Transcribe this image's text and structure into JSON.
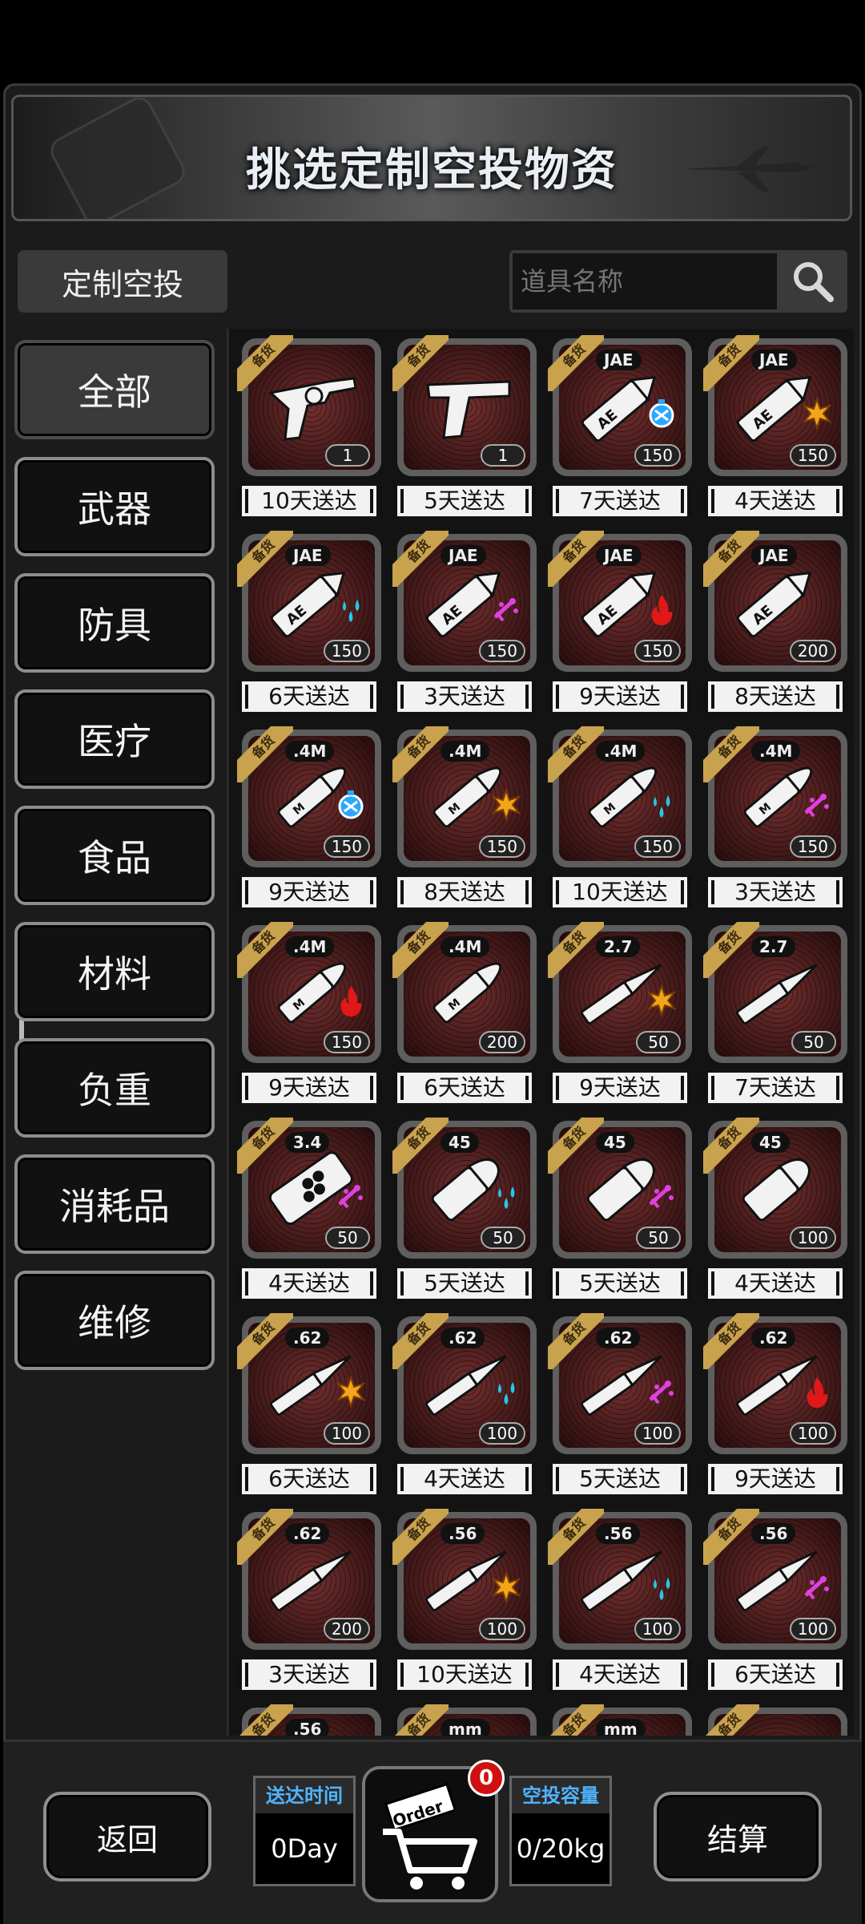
{
  "banner": {
    "title": "挑选定制空投物资"
  },
  "topbar": {
    "tab_label": "定制空投",
    "search_placeholder": "道具名称"
  },
  "sidebar": {
    "items": [
      {
        "label": "全部",
        "active": true
      },
      {
        "label": "武器"
      },
      {
        "label": "防具"
      },
      {
        "label": "医疗"
      },
      {
        "label": "食品"
      },
      {
        "label": "材料"
      },
      {
        "label": "负重"
      },
      {
        "label": "消耗品"
      },
      {
        "label": "维修"
      }
    ]
  },
  "grid": {
    "ribbon_label": "备货",
    "items": [
      {
        "tag": "",
        "icon": "revolver-icon",
        "effect": "",
        "qty": "1",
        "delivery": "10天送达"
      },
      {
        "tag": "",
        "icon": "pistol-icon",
        "effect": "",
        "qty": "1",
        "delivery": "5天送达"
      },
      {
        "tag": "JAE",
        "icon": "ammo-ae-icon",
        "effect": "armor-pierce-icon",
        "qty": "150",
        "delivery": "7天送达"
      },
      {
        "tag": "JAE",
        "icon": "ammo-ae-icon",
        "effect": "explosive-icon",
        "qty": "150",
        "delivery": "4天送达"
      },
      {
        "tag": "JAE",
        "icon": "ammo-ae-icon",
        "effect": "water-icon",
        "qty": "150",
        "delivery": "6天送达"
      },
      {
        "tag": "JAE",
        "icon": "ammo-ae-icon",
        "effect": "toxic-icon",
        "qty": "150",
        "delivery": "3天送达"
      },
      {
        "tag": "JAE",
        "icon": "ammo-ae-icon",
        "effect": "fire-icon",
        "qty": "150",
        "delivery": "9天送达"
      },
      {
        "tag": "JAE",
        "icon": "ammo-ae-icon",
        "effect": "",
        "qty": "200",
        "delivery": "8天送达"
      },
      {
        "tag": ".4M",
        "icon": "ammo-m-icon",
        "effect": "armor-pierce-icon",
        "qty": "150",
        "delivery": "9天送达"
      },
      {
        "tag": ".4M",
        "icon": "ammo-m-icon",
        "effect": "explosive-icon",
        "qty": "150",
        "delivery": "8天送达"
      },
      {
        "tag": ".4M",
        "icon": "ammo-m-icon",
        "effect": "water-icon",
        "qty": "150",
        "delivery": "10天送达"
      },
      {
        "tag": ".4M",
        "icon": "ammo-m-icon",
        "effect": "toxic-icon",
        "qty": "150",
        "delivery": "3天送达"
      },
      {
        "tag": ".4M",
        "icon": "ammo-m-icon",
        "effect": "fire-icon",
        "qty": "150",
        "delivery": "9天送达"
      },
      {
        "tag": ".4M",
        "icon": "ammo-m-icon",
        "effect": "",
        "qty": "200",
        "delivery": "6天送达"
      },
      {
        "tag": "2.7",
        "icon": "rifle-round-icon",
        "effect": "explosive-icon",
        "qty": "50",
        "delivery": "9天送达"
      },
      {
        "tag": "2.7",
        "icon": "rifle-round-icon",
        "effect": "",
        "qty": "50",
        "delivery": "7天送达"
      },
      {
        "tag": "3.4",
        "icon": "shotgun-shell-icon",
        "effect": "toxic-icon",
        "qty": "50",
        "delivery": "4天送达"
      },
      {
        "tag": "45",
        "icon": "pistol-round-icon",
        "effect": "water-icon",
        "qty": "50",
        "delivery": "5天送达"
      },
      {
        "tag": "45",
        "icon": "pistol-round-icon",
        "effect": "toxic-icon",
        "qty": "50",
        "delivery": "5天送达"
      },
      {
        "tag": "45",
        "icon": "pistol-round-icon",
        "effect": "",
        "qty": "100",
        "delivery": "4天送达"
      },
      {
        "tag": ".62",
        "icon": "rifle-round-icon",
        "effect": "explosive-icon",
        "qty": "100",
        "delivery": "6天送达"
      },
      {
        "tag": ".62",
        "icon": "rifle-round-icon",
        "effect": "water-icon",
        "qty": "100",
        "delivery": "4天送达"
      },
      {
        "tag": ".62",
        "icon": "rifle-round-icon",
        "effect": "toxic-icon",
        "qty": "100",
        "delivery": "5天送达"
      },
      {
        "tag": ".62",
        "icon": "rifle-round-icon",
        "effect": "fire-icon",
        "qty": "100",
        "delivery": "9天送达"
      },
      {
        "tag": ".62",
        "icon": "rifle-round-icon",
        "effect": "",
        "qty": "200",
        "delivery": "3天送达"
      },
      {
        "tag": ".56",
        "icon": "rifle-round-icon",
        "effect": "explosive-icon",
        "qty": "100",
        "delivery": "10天送达"
      },
      {
        "tag": ".56",
        "icon": "rifle-round-icon",
        "effect": "water-icon",
        "qty": "100",
        "delivery": "4天送达"
      },
      {
        "tag": ".56",
        "icon": "rifle-round-icon",
        "effect": "toxic-icon",
        "qty": "100",
        "delivery": "6天送达"
      },
      {
        "tag": ".56",
        "icon": "rifle-round-icon",
        "effect": "",
        "qty": "",
        "delivery": ""
      },
      {
        "tag": "mm",
        "icon": "rifle-round-icon",
        "effect": "",
        "qty": "",
        "delivery": ""
      },
      {
        "tag": "mm",
        "icon": "rifle-round-icon",
        "effect": "",
        "qty": "",
        "delivery": ""
      },
      {
        "tag": "",
        "icon": "rifle-round-icon",
        "effect": "",
        "qty": "",
        "delivery": ""
      }
    ]
  },
  "bottom": {
    "back_label": "返回",
    "delivery_time_label": "送达时间",
    "delivery_time_value": "0Day",
    "order_label": "Order",
    "order_count": "0",
    "capacity_label": "空投容量",
    "capacity_value": "0/20kg",
    "checkout_label": "结算"
  },
  "colors": {
    "ribbon": "#c9a24d",
    "info_label": "#4fb4ff",
    "badge": "#d01010",
    "tile_bg": "#3a0808"
  }
}
